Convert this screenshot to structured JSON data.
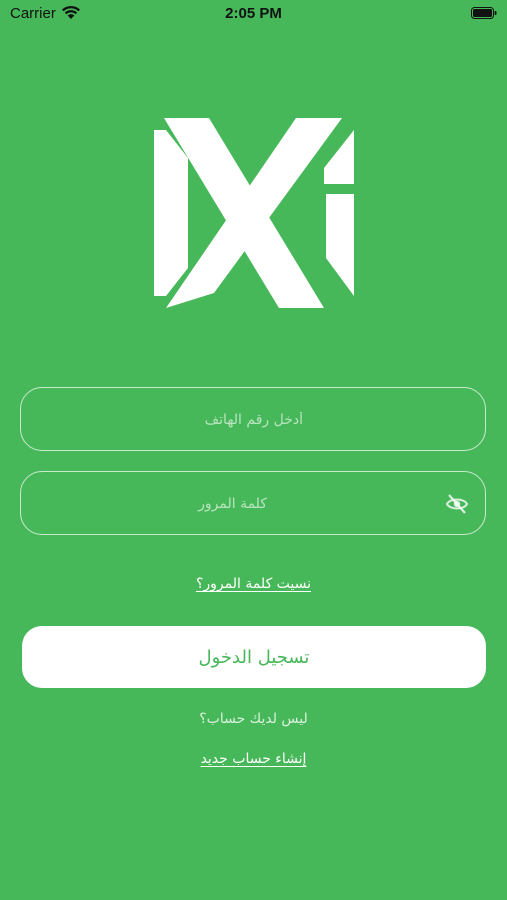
{
  "status_bar": {
    "carrier": "Carrier",
    "time": "2:05 PM",
    "icons": [
      "wifi-icon",
      "battery-icon"
    ]
  },
  "logo": {
    "icon": "x-brand-logo"
  },
  "form": {
    "phone_placeholder": "أدخل رقم الهاتف",
    "password_placeholder": "كلمة المرور",
    "password_toggle_icon": "eye-slash-icon"
  },
  "links": {
    "forgot_password": "نسيت كلمة المرور؟",
    "no_account": "ليس لديك حساب؟",
    "create_account": "إنشاء حساب جديد"
  },
  "buttons": {
    "login": "تسجيل الدخول"
  },
  "colors": {
    "background": "#47b859",
    "button_bg": "#ffffff",
    "button_text": "#47b859"
  }
}
